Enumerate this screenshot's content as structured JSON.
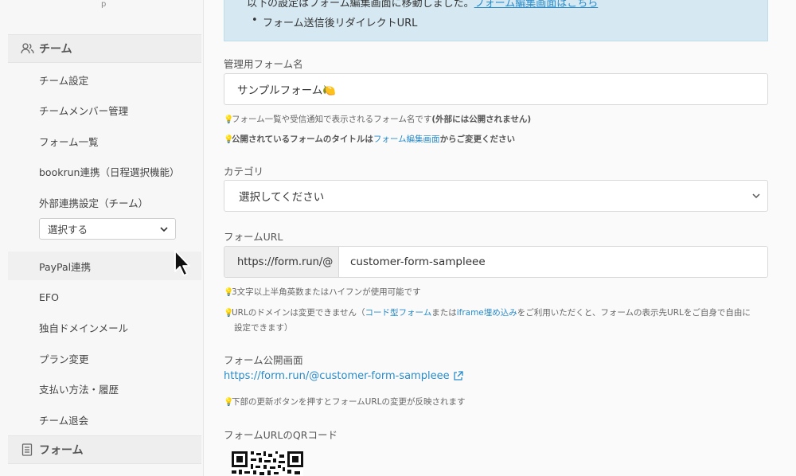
{
  "sidebar": {
    "top_text": "p",
    "team_section": {
      "label": "チーム",
      "icon": "users-icon"
    },
    "items": [
      {
        "label": "チーム設定"
      },
      {
        "label": "チームメンバー管理"
      },
      {
        "label": "フォーム一覧"
      },
      {
        "label": "bookrun連携（日程選択機能）"
      },
      {
        "label": "外部連携設定（チーム）"
      },
      {
        "label": "PayPal連携"
      },
      {
        "label": "EFO"
      },
      {
        "label": "独自ドメインメール"
      },
      {
        "label": "プラン変更"
      },
      {
        "label": "支払い方法・履歴"
      },
      {
        "label": "チーム退会"
      }
    ],
    "external_select": {
      "value": "選択する"
    },
    "form_section": {
      "label": "フォーム",
      "icon": "document-icon"
    }
  },
  "notice": {
    "line1_text": "以下の設定はフォーム編集画面に移動しました。",
    "line1_link": "フォーム編集画面はこちら",
    "bullet": "•",
    "line2": "フォーム送信後リダイレクトURL"
  },
  "form_name": {
    "label": "管理用フォーム名",
    "value": "サンプルフォーム🍋",
    "hint1_pre": "フォーム一覧や受信通知で表示されるフォーム名です",
    "hint1_bold": "(外部には公開されません)",
    "hint2_pre": "公開されているフォームのタイトルは",
    "hint2_link": "フォーム編集画面",
    "hint2_post": "からご変更ください"
  },
  "category": {
    "label": "カテゴリ",
    "value": "選択してください"
  },
  "form_url": {
    "label": "フォームURL",
    "prefix": "https://form.run/@",
    "value": "customer-form-sampleee",
    "hint1": "3文字以上半角英数またはハイフンが使用可能です",
    "hint2_pre": "URLのドメインは変更できません（",
    "hint2_link1": "コード型フォーム",
    "hint2_mid": "または",
    "hint2_link2": "iframe埋め込み",
    "hint2_post": "をご利用いただくと、フォームの表示先URLをご自身で自由に",
    "hint2_line2": "設定できます）"
  },
  "public_page": {
    "label": "フォーム公開画面",
    "link": "https://form.run/@customer-form-sampleee",
    "hint": "下部の更新ボタンを押すとフォームURLの変更が反映されます"
  },
  "qr": {
    "label": "フォームURLのQRコード"
  },
  "colors": {
    "link": "#2a8bc9",
    "notice_bg": "#d6e9f3",
    "bulb": "#e6b32a"
  }
}
